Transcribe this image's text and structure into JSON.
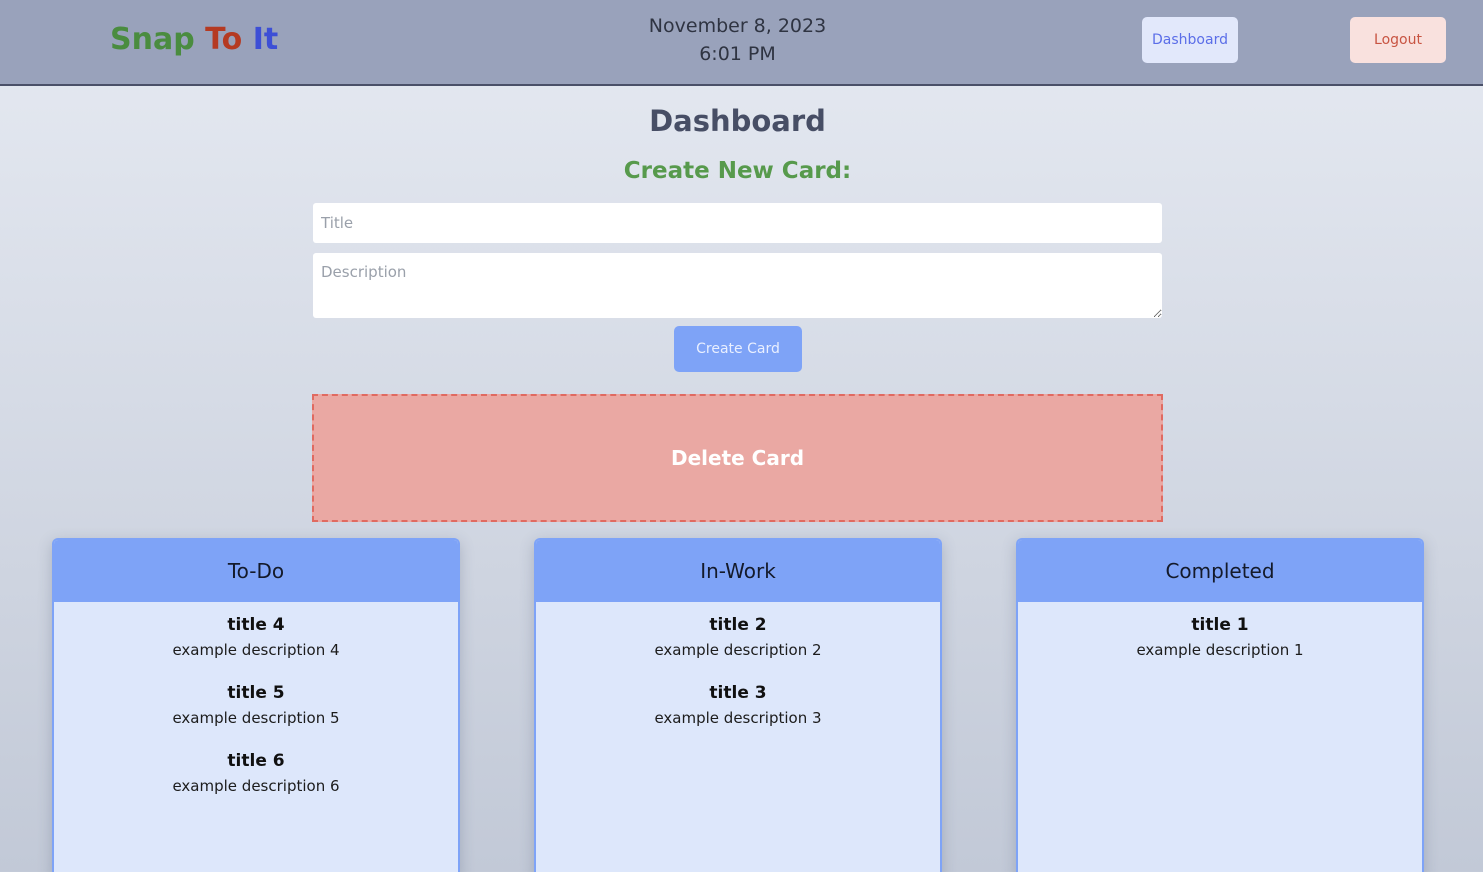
{
  "header": {
    "logo": {
      "word1": "Snap",
      "word2": "To",
      "word3": "It",
      "colors": {
        "word1": "#4a8c3f",
        "word2": "#b53a22",
        "word3": "#3d4fd6"
      }
    },
    "date": "November 8, 2023",
    "time": "6:01 PM",
    "dashboard_label": "Dashboard",
    "logout_label": "Logout"
  },
  "main": {
    "page_title": "Dashboard",
    "create_title": "Create New Card:",
    "title_placeholder": "Title",
    "title_value": "",
    "description_placeholder": "Description",
    "description_value": "",
    "create_button_label": "Create Card",
    "delete_zone_label": "Delete Card"
  },
  "columns": [
    {
      "name": "To-Do",
      "cards": [
        {
          "title": "title 4",
          "description": "example description 4"
        },
        {
          "title": "title 5",
          "description": "example description 5"
        },
        {
          "title": "title 6",
          "description": "example description 6"
        }
      ]
    },
    {
      "name": "In-Work",
      "cards": [
        {
          "title": "title 2",
          "description": "example description 2"
        },
        {
          "title": "title 3",
          "description": "example description 3"
        }
      ]
    },
    {
      "name": "Completed",
      "cards": [
        {
          "title": "title 1",
          "description": "example description 1"
        }
      ]
    }
  ],
  "colors": {
    "header_bg": "#99a2bb",
    "column_header": "#7ea3f7",
    "column_body": "#dde7fb",
    "delete_zone": "#eaa8a3",
    "create_title": "#579a4c"
  }
}
